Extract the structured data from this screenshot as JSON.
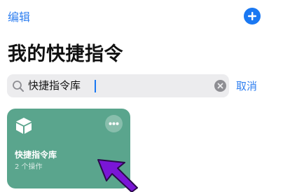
{
  "header": {
    "edit_label": "编辑",
    "add_icon": "plus-icon"
  },
  "page": {
    "title": "我的快捷指令"
  },
  "search": {
    "value": "快捷指令库",
    "cancel_label": "取消",
    "search_icon": "magnifier-icon",
    "clear_icon": "clear-x-icon"
  },
  "card": {
    "title": "快捷指令库",
    "subtitle": "2 个操作",
    "icon": "cube-icon",
    "more_icon": "ellipsis-icon",
    "color": "#5aa58d"
  },
  "colors": {
    "accent": "#1a78f2",
    "link": "#2f7ff0",
    "annotation_arrow": "#7a16d6"
  }
}
